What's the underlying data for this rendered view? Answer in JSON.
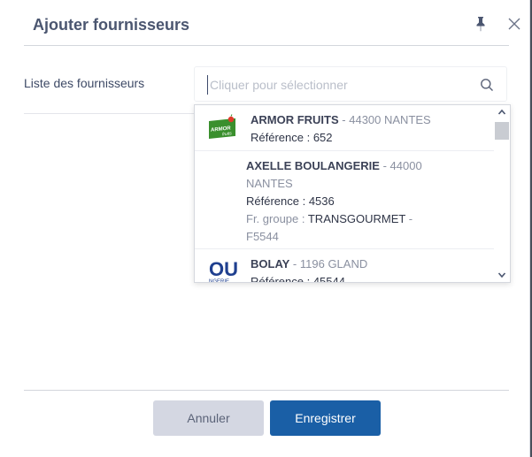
{
  "dialog": {
    "title": "Ajouter fournisseurs",
    "field_label": "Liste des fournisseurs",
    "search": {
      "placeholder": "Cliquer pour sélectionner",
      "value": ""
    },
    "suppliers": [
      {
        "name": "ARMOR FRUITS",
        "sep": " - ",
        "location": "44300 NANTES",
        "reference_label": "Référence : ",
        "reference": "652",
        "logo": "armor-fruits-logo"
      },
      {
        "name": "AXELLE BOULANGERIE",
        "sep": " - ",
        "location_line1": "44000",
        "location_line2": "NANTES",
        "reference_label": "Référence : ",
        "reference": "4536",
        "group_label": "Fr. groupe : ",
        "group_value": "TRANSGOURMET",
        "group_sep": " -",
        "group_code": "F5544"
      },
      {
        "name": "BOLAY",
        "sep": " - ",
        "location": "1196 GLAND",
        "reference_label": "Référence : ",
        "reference": "45544",
        "logo": "bolay-logo"
      }
    ],
    "buttons": {
      "cancel": "Annuler",
      "save": "Enregistrer"
    }
  },
  "colors": {
    "title": "#4b5670",
    "primary": "#1a5fa6",
    "cancel_bg": "#d4d7e2",
    "overlay": "#4a4f5a"
  },
  "icons": {
    "pin": "pin-icon",
    "close": "close-icon",
    "search": "search-icon",
    "scroll_up": "chevron-up-icon",
    "scroll_down": "chevron-down-icon"
  }
}
